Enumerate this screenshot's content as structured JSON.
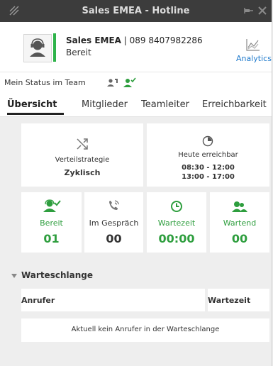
{
  "window": {
    "title": "Sales EMEA - Hotline"
  },
  "contact": {
    "name": "Sales EMEA",
    "separator": " | ",
    "number": "089 8407982286",
    "status": "Bereit"
  },
  "analytics": {
    "label": "Analytics"
  },
  "team_status": {
    "label": "Mein Status im Team"
  },
  "tabs": [
    {
      "label": "Übersicht",
      "active": true
    },
    {
      "label": "Mitglieder",
      "active": false
    },
    {
      "label": "Teamleiter",
      "active": false
    },
    {
      "label": "Erreichbarkeit",
      "active": false
    }
  ],
  "overview": {
    "distribution": {
      "label": "Verteilstrategie",
      "value": "Zyklisch"
    },
    "reachable": {
      "label": "Heute erreichbar",
      "times": [
        "08:30 - 12:00",
        "13:00 - 17:00"
      ]
    }
  },
  "metrics": [
    {
      "label": "Bereit",
      "value": "01",
      "color": "#2e9e3e"
    },
    {
      "label": "Im Gespräch",
      "value": "00",
      "color": "#333333"
    },
    {
      "label": "Wartezeit",
      "value": "00:00",
      "color": "#2e9e3e"
    },
    {
      "label": "Wartend",
      "value": "00",
      "color": "#2e9e3e"
    }
  ],
  "queue": {
    "title": "Warteschlange",
    "columns": [
      "Anrufer",
      "Wartezeit"
    ],
    "empty_message": "Aktuell kein Anrufer in der Warteschlange"
  },
  "colors": {
    "titlebar": "#3c3c3c",
    "accent_green": "#2eb34a",
    "link_blue": "#1f7acc"
  }
}
